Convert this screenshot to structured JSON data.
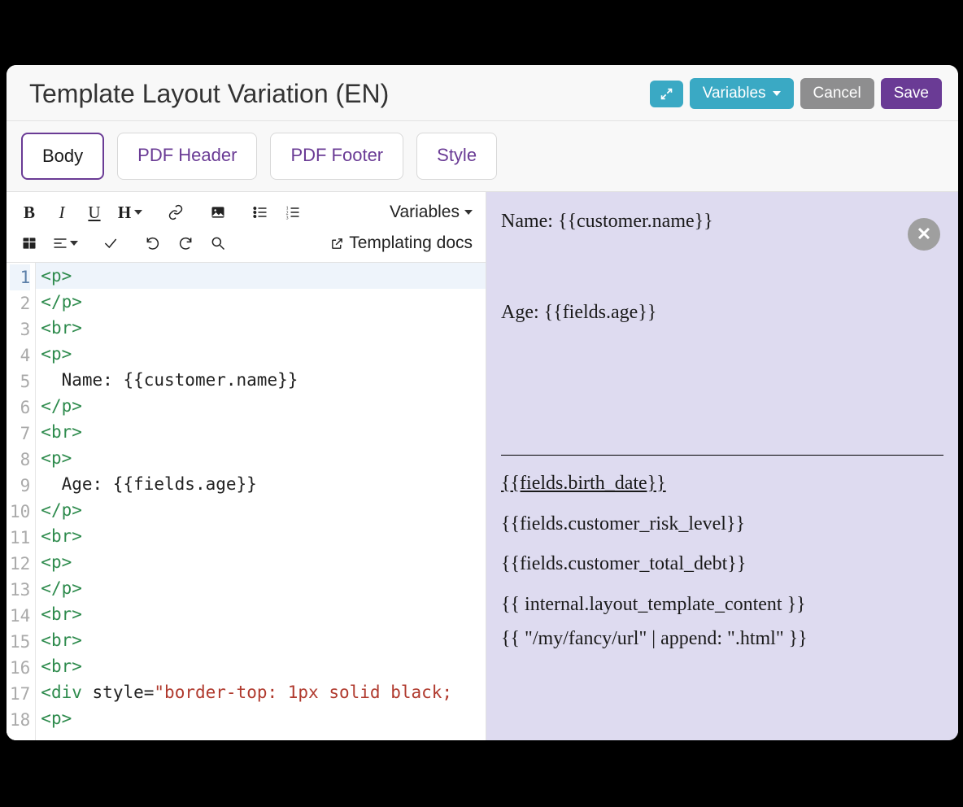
{
  "header": {
    "title": "Template Layout Variation (EN)",
    "variables_label": "Variables",
    "cancel_label": "Cancel",
    "save_label": "Save"
  },
  "tabs": {
    "body": "Body",
    "pdf_header": "PDF Header",
    "pdf_footer": "PDF Footer",
    "style": "Style"
  },
  "toolbar": {
    "variables_dropdown": "Variables",
    "templating_docs": "Templating docs",
    "heading_label": "H"
  },
  "code_lines": [
    {
      "n": "1",
      "html": "<span class='tag'>&lt;p&gt;</span>",
      "hl": true
    },
    {
      "n": "2",
      "html": "<span class='tag'>&lt;/p&gt;</span>"
    },
    {
      "n": "3",
      "html": "<span class='tag'>&lt;br&gt;</span>"
    },
    {
      "n": "4",
      "html": "<span class='tag'>&lt;p&gt;</span>"
    },
    {
      "n": "5",
      "html": "  Name: {{customer.name}}"
    },
    {
      "n": "6",
      "html": "<span class='tag'>&lt;/p&gt;</span>"
    },
    {
      "n": "7",
      "html": "<span class='tag'>&lt;br&gt;</span>"
    },
    {
      "n": "8",
      "html": "<span class='tag'>&lt;p&gt;</span>"
    },
    {
      "n": "9",
      "html": "  Age: {{fields.age}}"
    },
    {
      "n": "10",
      "html": "<span class='tag'>&lt;/p&gt;</span>"
    },
    {
      "n": "11",
      "html": "<span class='tag'>&lt;br&gt;</span>"
    },
    {
      "n": "12",
      "html": "<span class='tag'>&lt;p&gt;</span>"
    },
    {
      "n": "13",
      "html": "<span class='tag'>&lt;/p&gt;</span>"
    },
    {
      "n": "14",
      "html": "<span class='tag'>&lt;br&gt;</span>"
    },
    {
      "n": "15",
      "html": "<span class='tag'>&lt;br&gt;</span>"
    },
    {
      "n": "16",
      "html": "<span class='tag'>&lt;br&gt;</span>"
    },
    {
      "n": "17",
      "html": "<span class='tag'>&lt;div</span> <span class='attr'>style</span>=<span class='str'>\"border-top: 1px solid black;</span>"
    },
    {
      "n": "18",
      "html": "<span class='tag'>&lt;p&gt;</span>"
    }
  ],
  "preview": {
    "name_line": "Name: {{customer.name}}",
    "age_line": "Age: {{fields.age}}",
    "birth_date": "{{fields.birth_date}}",
    "risk": "{{fields.customer_risk_level}}",
    "debt": "{{fields.customer_total_debt}}",
    "layout_content": "{{ internal.layout_template_content }}",
    "append_expr": "{{ \"/my/fancy/url\" | append: \".html\" }}"
  }
}
